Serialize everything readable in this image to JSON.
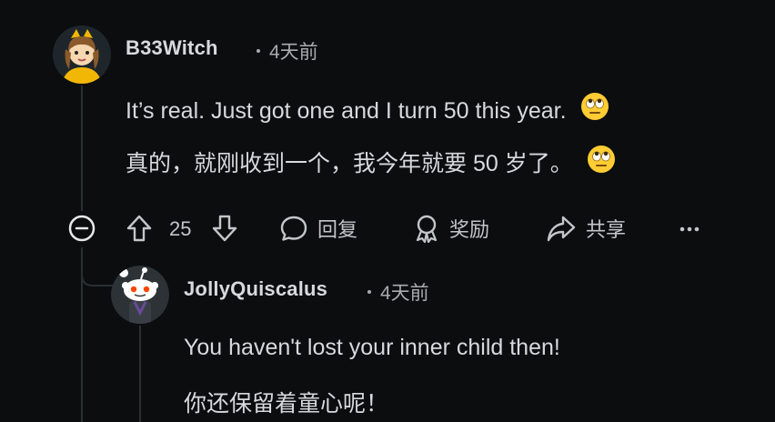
{
  "comment": {
    "username": "B33Witch",
    "time": "4天前",
    "text_en": "It’s real. Just got one and I turn 50 this year.",
    "text_zh": "真的，就刚收到一个，我今年就要 50 岁了。",
    "emoji": "face-with-rolling-eyes",
    "actions": {
      "vote_count": "25",
      "reply_label": "回复",
      "award_label": "奖励",
      "share_label": "共享"
    }
  },
  "reply": {
    "username": "JollyQuiscalus",
    "time": "4天前",
    "text_en": "You haven't lost your inner child then!",
    "text_zh": "你还保留着童心呢！"
  },
  "colors": {
    "background": "#0b0d0f",
    "text": "#d7dadc",
    "muted": "#a8acb0",
    "thread_line": "#2a2f33"
  }
}
